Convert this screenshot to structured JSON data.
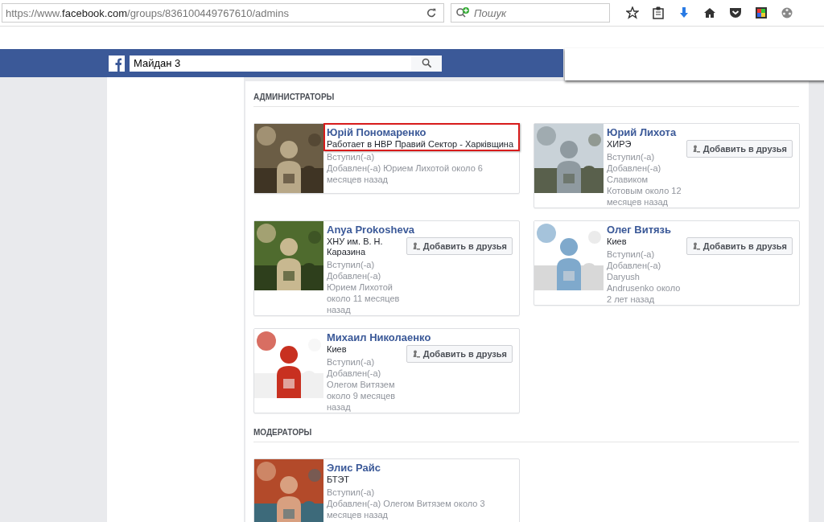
{
  "browser": {
    "url_prefix": "https://www.",
    "url_domain": "facebook.com",
    "url_rest": "/groups/836100449767610/admins",
    "search_placeholder": "Пошук"
  },
  "header": {
    "search_value": "Майдан 3"
  },
  "sections": [
    {
      "title": "АДМИНИСТРАТОРЫ",
      "members": [
        {
          "name": "Юрій Пономаренко",
          "info": "Работает в НВР Правий Сектор - Харківщина",
          "joined": "Вступил(-а)",
          "added": "Добавлен(-а) Юрием Лихотой около 6 месяцев назад",
          "highlighted": true
        },
        {
          "name": "Юрий Лихота",
          "info": "ХИРЭ",
          "joined": "Вступил(-а)",
          "added": "Добавлен(-а) Славиком Котовым около 12 месяцев назад",
          "highlighted": false,
          "button": "Добавить в друзья"
        },
        {
          "name": "Anya Prokosheva",
          "info": "ХНУ им. В. Н. Каразина",
          "joined": "Вступил(-а)",
          "added": "Добавлен(-а) Юрием Лихотой около 11 месяцев назад",
          "highlighted": false,
          "button": "Добавить в друзья"
        },
        {
          "name": "Олег Витязь",
          "info": "Киев",
          "joined": "Вступил(-а)",
          "added": "Добавлен(-а) Daryush Andrusenko около 2 лет назад",
          "highlighted": false,
          "button": "Добавить в друзья"
        },
        {
          "name": "Михаил Николаенко",
          "info": "Киев",
          "joined": "Вступил(-а)",
          "added": "Добавлен(-а) Олегом Витязем около 9 месяцев назад",
          "highlighted": false,
          "button": "Добавить в друзья"
        }
      ]
    },
    {
      "title": "МОДЕРАТОРЫ",
      "members": [
        {
          "name": "Элис Райс",
          "info": "БТЭТ",
          "joined": "Вступил(-а)",
          "added": "Добавлен(-а) Олегом Витязем около 3 месяцев назад",
          "highlighted": false
        }
      ]
    }
  ]
}
